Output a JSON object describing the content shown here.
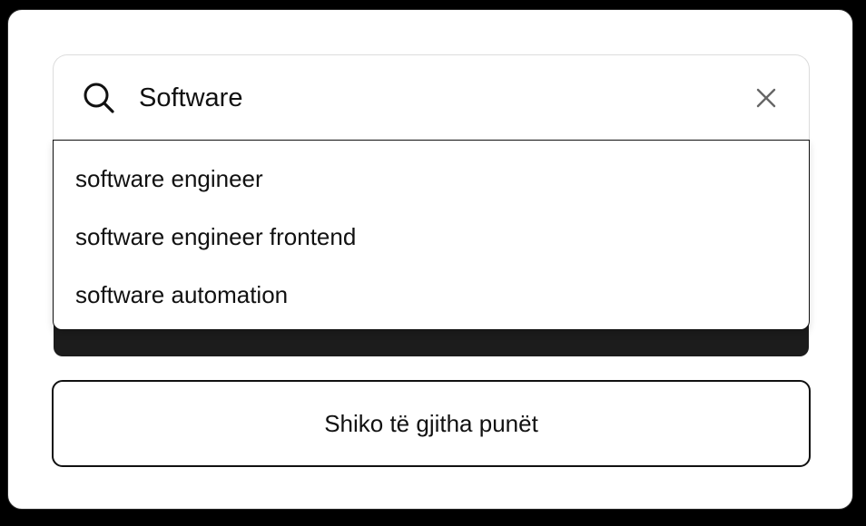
{
  "search": {
    "value": "Software",
    "icon": "search-icon",
    "clear_icon": "close-icon"
  },
  "suggestions": [
    {
      "label": "software engineer"
    },
    {
      "label": "software engineer frontend"
    },
    {
      "label": "software automation"
    }
  ],
  "view_all": {
    "label": "Shiko të gjitha punët"
  },
  "colors": {
    "background": "#000000",
    "card": "#ffffff",
    "text": "#111111",
    "hidden_button": "#1c1c1c",
    "icon_gray": "#666666"
  }
}
